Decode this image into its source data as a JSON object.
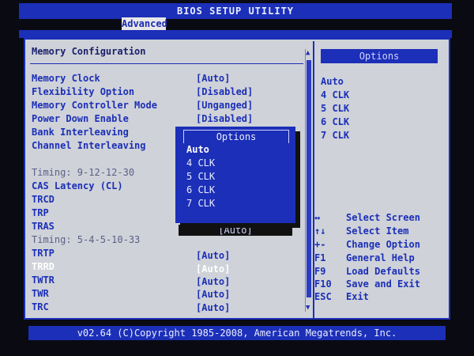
{
  "title": "BIOS SETUP UTILITY",
  "active_tab": "Advanced",
  "section_header": "Memory Configuration",
  "settings": [
    {
      "label": "Memory Clock",
      "value": "[Auto]"
    },
    {
      "label": "Flexibility Option",
      "value": "[Disabled]"
    },
    {
      "label": "Memory Controller Mode",
      "value": "[Unganged]"
    },
    {
      "label": "Power Down Enable",
      "value": "[Disabled]"
    },
    {
      "label": "Bank Interleaving",
      "value": ""
    },
    {
      "label": "Channel Interleaving",
      "value": ""
    }
  ],
  "timing_group1": {
    "label": "Timing: 9-12-12-30",
    "items": [
      {
        "label": "CAS Latency (CL)",
        "value": ""
      },
      {
        "label": "TRCD",
        "value": ""
      },
      {
        "label": "TRP",
        "value": ""
      },
      {
        "label": "TRAS",
        "value": "[Auto]"
      }
    ]
  },
  "timing_group2": {
    "label": "Timing: 5-4-5-10-33",
    "items": [
      {
        "label": "TRTP",
        "value": "[Auto]"
      },
      {
        "label": "TRRD",
        "value": "[Auto]"
      },
      {
        "label": "TWTR",
        "value": "[Auto]"
      },
      {
        "label": "TWR",
        "value": "[Auto]"
      },
      {
        "label": "TRC",
        "value": "[Auto]"
      }
    ]
  },
  "popup": {
    "title": "Options",
    "options": [
      "Auto",
      "4 CLK",
      "5 CLK",
      "6 CLK",
      "7 CLK"
    ],
    "selected": "Auto"
  },
  "right_panel": {
    "title": "Options",
    "options": [
      "Auto",
      "4 CLK",
      "5 CLK",
      "6 CLK",
      "7 CLK"
    ]
  },
  "help_keys": [
    {
      "key": "↔",
      "desc": "Select Screen"
    },
    {
      "key": "↑↓",
      "desc": "Select Item"
    },
    {
      "key": "+-",
      "desc": "Change Option"
    },
    {
      "key": "F1",
      "desc": "General Help"
    },
    {
      "key": "F9",
      "desc": "Load Defaults"
    },
    {
      "key": "F10",
      "desc": "Save and Exit"
    },
    {
      "key": "ESC",
      "desc": "Exit"
    }
  ],
  "footer": "v02.64 (C)Copyright 1985-2008, American Megatrends, Inc.",
  "icons": {
    "scroll_up": "triangle-up",
    "scroll_down": "triangle-down"
  },
  "colors": {
    "bios_blue": "#1c2fb8",
    "panel_gray": "#cfd2d8",
    "highlight": "#ffffff"
  }
}
